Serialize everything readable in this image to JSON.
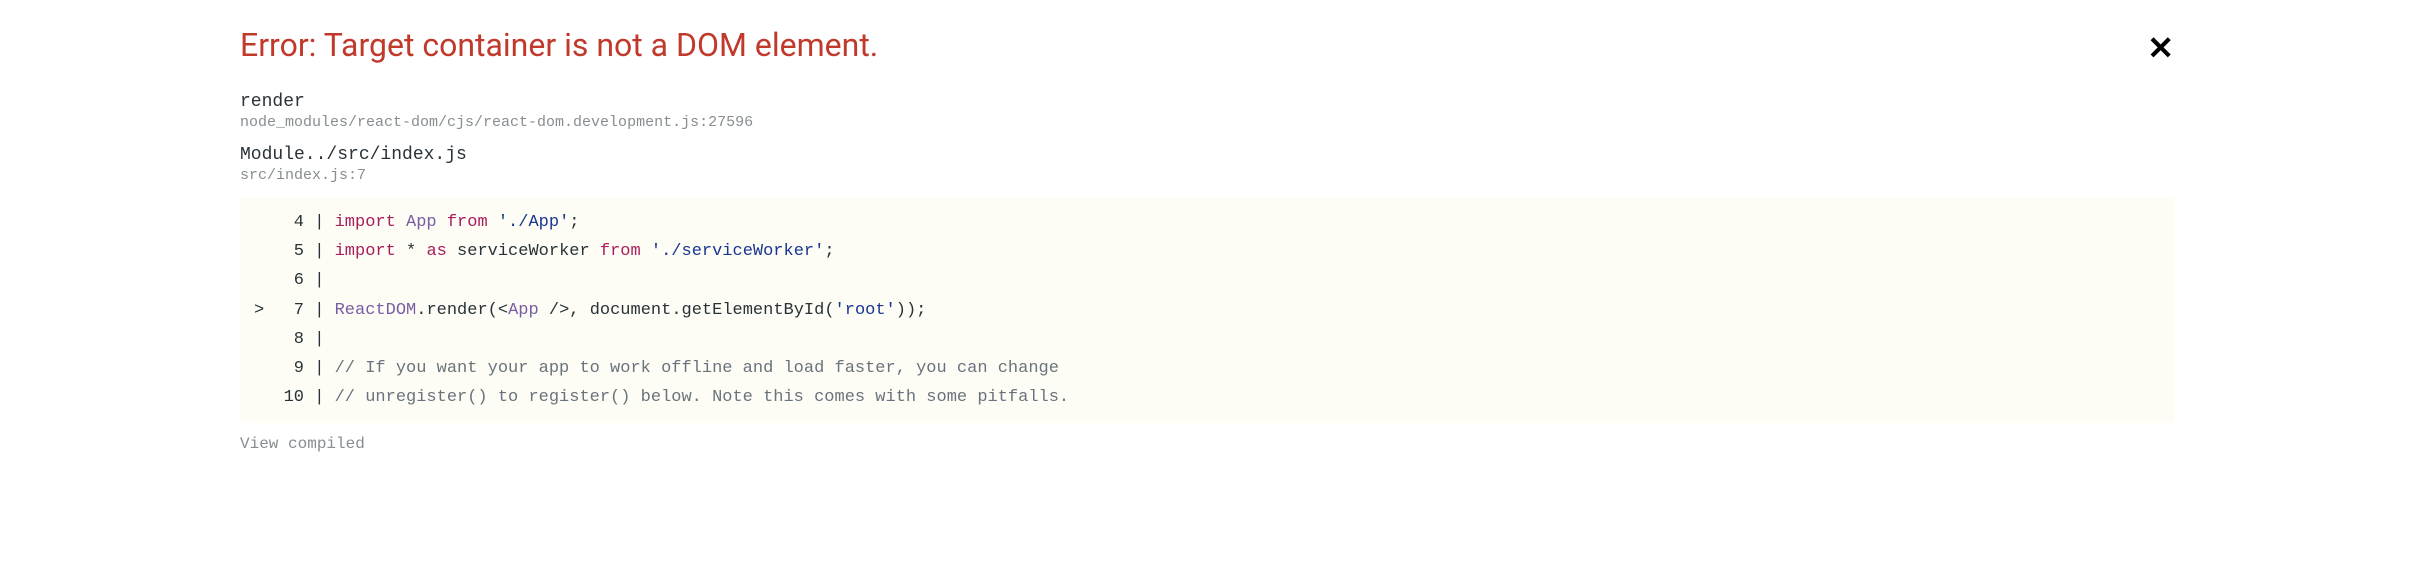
{
  "error_title": "Error: Target container is not a DOM element.",
  "close_glyph": "✕",
  "frames": [
    {
      "function": "render",
      "source": "node_modules/react-dom/cjs/react-dom.development.js:27596"
    },
    {
      "function": "Module../src/index.js",
      "source": "src/index.js:7"
    }
  ],
  "code": {
    "lines": {
      "l4": {
        "num": "4",
        "kw": "import",
        "ident": "App",
        "from": "from",
        "str": "'./App'",
        "semi": ";"
      },
      "l5": {
        "num": "5",
        "kw": "import",
        "star": "*",
        "as": "as",
        "ident": "serviceWorker",
        "from": "from",
        "str": "'./serviceWorker'",
        "semi": ";"
      },
      "l6": {
        "num": "6"
      },
      "l7": {
        "num": "7",
        "marker": ">",
        "obj": "ReactDOM",
        "dot": ".",
        "method": "render",
        "open": "(<",
        "comp": "App",
        "selfclose": " />",
        "comma": ", ",
        "doc": "document",
        "dot2": ".",
        "gid": "getElementById",
        "open2": "(",
        "rootstr": "'root'",
        "close": "));"
      },
      "l8": {
        "num": "8"
      },
      "l9": {
        "num": "9",
        "comment": "// If you want your app to work offline and load faster, you can change"
      },
      "l10": {
        "num": "10",
        "comment": "// unregister() to register() below. Note this comes with some pitfalls."
      }
    }
  },
  "view_compiled": "View compiled"
}
